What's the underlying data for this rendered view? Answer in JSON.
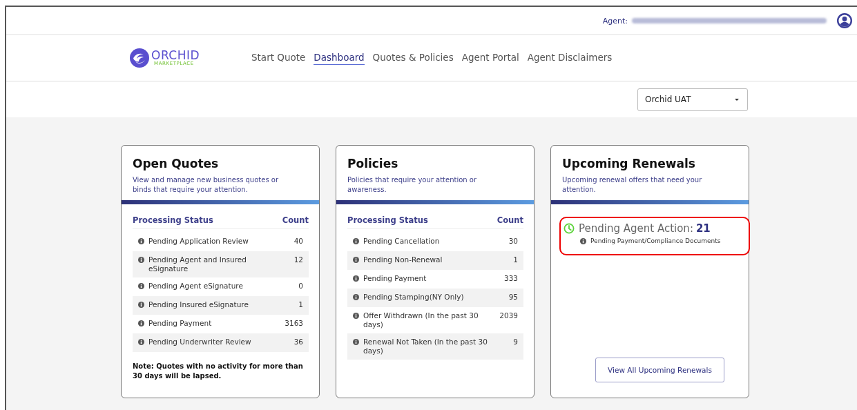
{
  "top_bar": {
    "agent_label": "Agent:"
  },
  "brand": {
    "name": "ORCHID",
    "tagline": "MARKETPLACE"
  },
  "nav": [
    {
      "label": "Start Quote",
      "selected": false
    },
    {
      "label": "Dashboard",
      "selected": true
    },
    {
      "label": "Quotes & Policies",
      "selected": false
    },
    {
      "label": "Agent Portal",
      "selected": false
    },
    {
      "label": "Agent Disclaimers",
      "selected": false
    }
  ],
  "environment_select": {
    "value": "Orchid UAT"
  },
  "cards": [
    {
      "kind": "table",
      "title": "Open Quotes",
      "description": "View and manage new business quotes or binds that require your attention.",
      "columns": [
        "Processing Status",
        "Count"
      ],
      "rows": [
        {
          "status": "Pending Application Review",
          "count": "40"
        },
        {
          "status": "Pending Agent and Insured eSignature",
          "count": "12"
        },
        {
          "status": "Pending Agent eSignature",
          "count": "0"
        },
        {
          "status": "Pending Insured eSignature",
          "count": "1"
        },
        {
          "status": "Pending Payment",
          "count": "3163"
        },
        {
          "status": "Pending Underwriter Review",
          "count": "36"
        }
      ],
      "note": "Note: Quotes with no activity for more than 30 days will be lapsed."
    },
    {
      "kind": "table",
      "title": "Policies",
      "description": "Policies that require your attention or awareness.",
      "columns": [
        "Processing Status",
        "Count"
      ],
      "rows": [
        {
          "status": "Pending Cancellation",
          "count": "30"
        },
        {
          "status": "Pending Non-Renewal",
          "count": "1"
        },
        {
          "status": "Pending Payment",
          "count": "333"
        },
        {
          "status": "Pending Stamping(NY Only)",
          "count": "95"
        },
        {
          "status": "Offer Withdrawn (In the past 30 days)",
          "count": "2039"
        },
        {
          "status": "Renewal Not Taken (In the past 30 days)",
          "count": "9"
        }
      ]
    },
    {
      "kind": "renewals",
      "title": "Upcoming Renewals",
      "description": "Upcoming renewal offers that need your attention.",
      "action": {
        "label": "Pending Agent Action:",
        "count": "21",
        "detail": "Pending Payment/Compliance Documents",
        "highlighted": true
      },
      "button": "View All Upcoming Renewals"
    }
  ]
}
